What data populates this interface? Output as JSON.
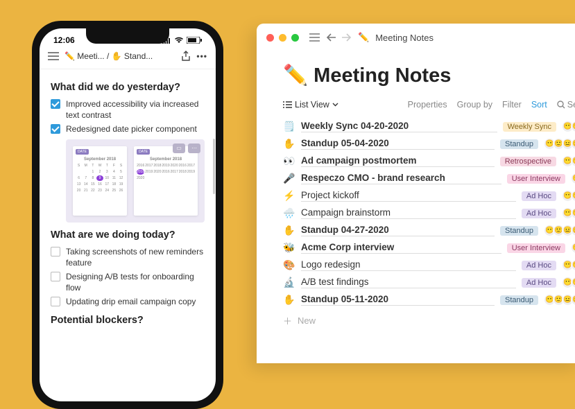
{
  "phone": {
    "time": "12:06",
    "breadcrumb": "✏️ Meeti...  /  ✋ Stand...",
    "h1": "What did we do yesterday?",
    "done1": "Improved accessibility via increased text contrast",
    "done2": "Redesigned date picker component",
    "cal_month": "September 2018",
    "h2": "What are we doing today?",
    "todo1": "Taking screenshots of new reminders feature",
    "todo2": "Designing A/B tests for onboarding flow",
    "todo3": "Updating drip email campaign copy",
    "h3": "Potential blockers?"
  },
  "window": {
    "title": "Meeting Notes",
    "title_emoji": "✏️",
    "h1": "✏️ Meeting Notes",
    "view_label": "List View",
    "tb_properties": "Properties",
    "tb_group": "Group by",
    "tb_filter": "Filter",
    "tb_sort": "Sort",
    "tb_search": "Sea",
    "new_label": "New",
    "tags": {
      "weekly": {
        "text": "Weekly Sync",
        "bg": "#fdecc8",
        "fg": "#8a6a1f"
      },
      "standup": {
        "text": "Standup",
        "bg": "#d6e4ee",
        "fg": "#3a5a73"
      },
      "retro": {
        "text": "Retrospective",
        "bg": "#f7d9e3",
        "fg": "#8a3a57"
      },
      "interview": {
        "text": "User Interview",
        "bg": "#fad6e6",
        "fg": "#8d3a63"
      },
      "adhoc": {
        "text": "Ad Hoc",
        "bg": "#e3dbf3",
        "fg": "#5a4a82"
      }
    },
    "rows": [
      {
        "emoji": "🗒️",
        "title": "Weekly Sync 04-20-2020",
        "tag": "weekly",
        "bold": true,
        "av": 2
      },
      {
        "emoji": "✋",
        "title": "Standup 05-04-2020",
        "tag": "standup",
        "bold": true,
        "av": 4
      },
      {
        "emoji": "👀",
        "title": "Ad campaign postmortem",
        "tag": "retro",
        "bold": true,
        "av": 2
      },
      {
        "emoji": "🎤",
        "title": "Respeczo CMO - brand research",
        "tag": "interview",
        "bold": true,
        "av": 1
      },
      {
        "emoji": "⚡",
        "title": "Project kickoff",
        "tag": "adhoc",
        "bold": false,
        "av": 2
      },
      {
        "emoji": "🌧️",
        "title": "Campaign brainstorm",
        "tag": "adhoc",
        "bold": false,
        "av": 2
      },
      {
        "emoji": "✋",
        "title": "Standup 04-27-2020",
        "tag": "standup",
        "bold": true,
        "av": 4
      },
      {
        "emoji": "🐝",
        "title": "Acme Corp interview",
        "tag": "interview",
        "bold": true,
        "av": 1
      },
      {
        "emoji": "🎨",
        "title": "Logo redesign",
        "tag": "adhoc",
        "bold": false,
        "av": 2
      },
      {
        "emoji": "🔬",
        "title": "A/B test findings",
        "tag": "adhoc",
        "bold": false,
        "av": 2
      },
      {
        "emoji": "✋",
        "title": "Standup 05-11-2020",
        "tag": "standup",
        "bold": true,
        "av": 4
      }
    ]
  }
}
